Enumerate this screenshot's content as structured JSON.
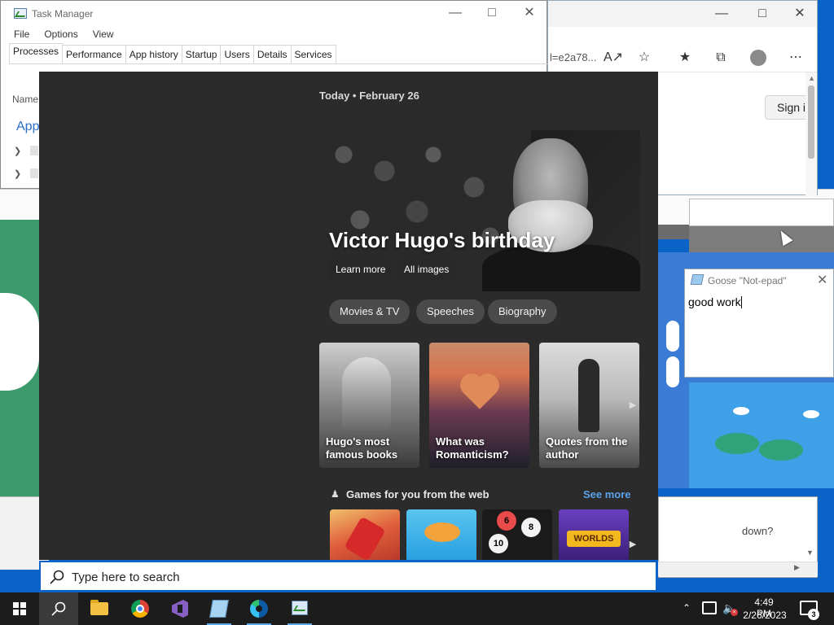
{
  "task_manager": {
    "title": "Task Manager",
    "menu": [
      "File",
      "Options",
      "View"
    ],
    "tabs": [
      "Processes",
      "Performance",
      "App history",
      "Startup",
      "Users",
      "Details",
      "Services"
    ],
    "active_tab": "Processes",
    "name_header": "Name",
    "apps_group": "App"
  },
  "edge": {
    "url_fragment": "l=e2a78...",
    "sign_in": "Sign i"
  },
  "search_panel": {
    "date_line": "Today  •  February 26",
    "hero": {
      "title": "Victor Hugo's birthday",
      "buttons": [
        "Learn more",
        "All images"
      ]
    },
    "chips": [
      "Movies & TV",
      "Speeches",
      "Biography"
    ],
    "cards": [
      {
        "label": "Hugo's most famous books"
      },
      {
        "label": "What was Romanticism?"
      },
      {
        "label": "Quotes from the author"
      }
    ],
    "games": {
      "title": "Games for you from the web",
      "see_more": "See more",
      "worlds_label": "WORLDS",
      "ball_numbers": [
        "6",
        "8",
        "10"
      ]
    },
    "search_placeholder": "Type here to search"
  },
  "goose_notepad": {
    "title": "Goose \"Not-epad\"",
    "text": "good work"
  },
  "lower_window": {
    "text": "down?"
  },
  "taskbar": {
    "apps": [
      "start",
      "search",
      "file-explorer",
      "chrome",
      "visual-studio",
      "notepad",
      "edge",
      "task-manager"
    ],
    "clock_time": "4:49 PM",
    "clock_date": "2/26/2023",
    "notification_count": "3"
  },
  "colors": {
    "accent": "#0a64c8",
    "panel_bg": "#2b2b2b",
    "link": "#5aa3ea"
  }
}
